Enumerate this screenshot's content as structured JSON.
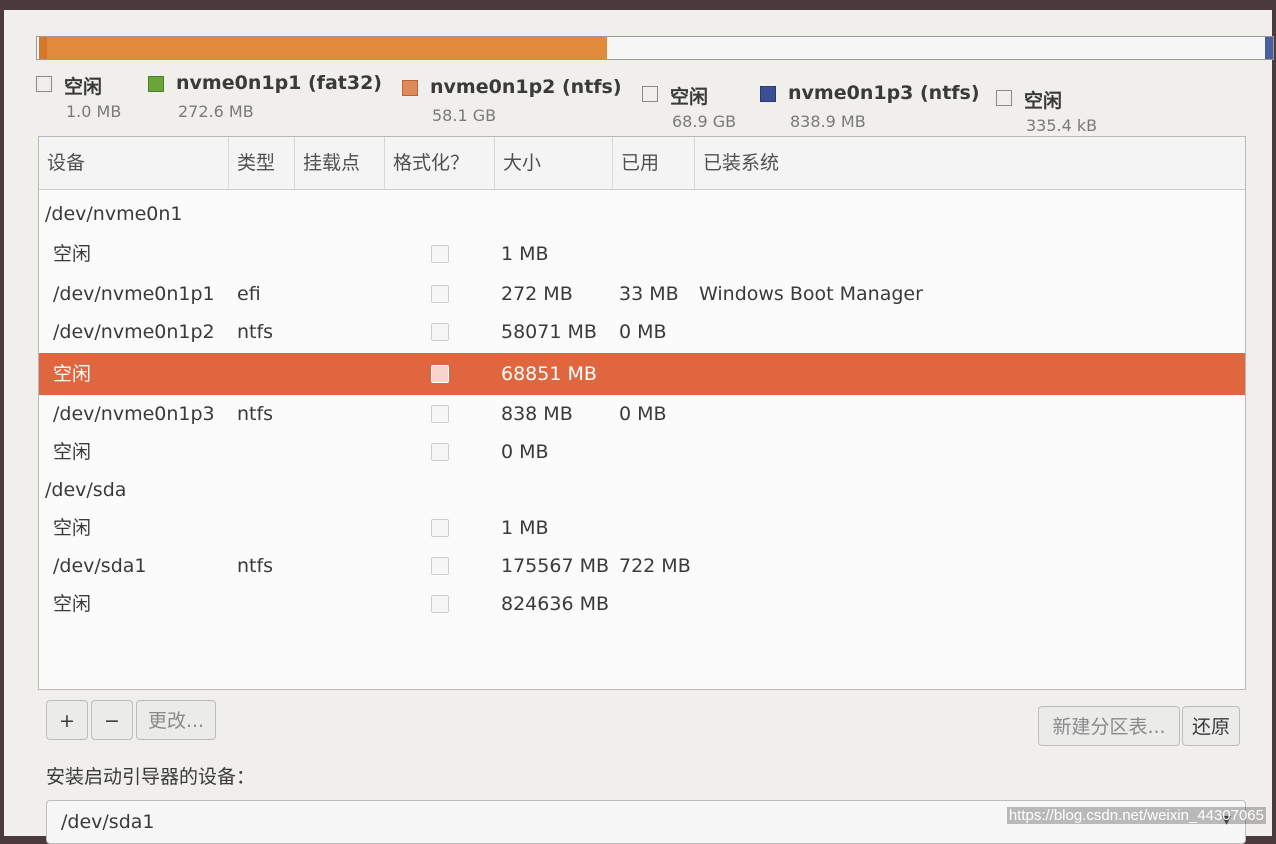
{
  "legend": [
    {
      "name": "空闲",
      "size": "1.0 MB",
      "color": "#f7f7f7"
    },
    {
      "name": "nvme0n1p1 (fat32)",
      "size": "272.6 MB",
      "color": "#6aa637"
    },
    {
      "name": "nvme0n1p2 (ntfs)",
      "size": "58.1 GB",
      "color": "#e08a5a"
    },
    {
      "name": "空闲",
      "size": "68.9 GB",
      "color": "#f7f7f7"
    },
    {
      "name": "nvme0n1p3 (ntfs)",
      "size": "838.9 MB",
      "color": "#3b4f93"
    },
    {
      "name": "空闲",
      "size": "335.4 kB",
      "color": "#f7f7f7"
    }
  ],
  "table": {
    "headers": [
      "设备",
      "类型",
      "挂载点",
      "格式化？",
      "大小",
      "已用",
      "已装系统"
    ],
    "rows": [
      {
        "device": "/dev/nvme0n1",
        "type": "",
        "mount": "",
        "format": "",
        "size": "",
        "used": "",
        "system": "",
        "group": true
      },
      {
        "device": "空闲",
        "type": "",
        "size": "1 MB",
        "used": "",
        "system": ""
      },
      {
        "device": "/dev/nvme0n1p1",
        "type": "efi",
        "size": "272 MB",
        "used": "33 MB",
        "system": "Windows Boot Manager"
      },
      {
        "device": "/dev/nvme0n1p2",
        "type": "ntfs",
        "size": "58071 MB",
        "used": "0 MB",
        "system": ""
      },
      {
        "device": "空闲",
        "type": "",
        "size": "68851 MB",
        "used": "",
        "system": "",
        "selected": true
      },
      {
        "device": "/dev/nvme0n1p3",
        "type": "ntfs",
        "size": "838 MB",
        "used": "0 MB",
        "system": ""
      },
      {
        "device": "空闲",
        "type": "",
        "size": "0 MB",
        "used": "",
        "system": ""
      },
      {
        "device": "/dev/sda",
        "type": "",
        "size": "",
        "used": "",
        "system": "",
        "group": true
      },
      {
        "device": "空闲",
        "type": "",
        "size": "1 MB",
        "used": "",
        "system": ""
      },
      {
        "device": "/dev/sda1",
        "type": "ntfs",
        "size": "175567 MB",
        "used": "722 MB",
        "system": ""
      },
      {
        "device": "空闲",
        "type": "",
        "size": "824636 MB",
        "used": "",
        "system": ""
      }
    ]
  },
  "buttons": {
    "add": "+",
    "remove": "−",
    "change": "更改...",
    "new_table": "新建分区表...",
    "revert": "还原"
  },
  "boot": {
    "label": "安装启动引导器的设备：",
    "value": "/dev/sda1"
  },
  "watermark": "https://blog.csdn.net/weixin_44307065"
}
